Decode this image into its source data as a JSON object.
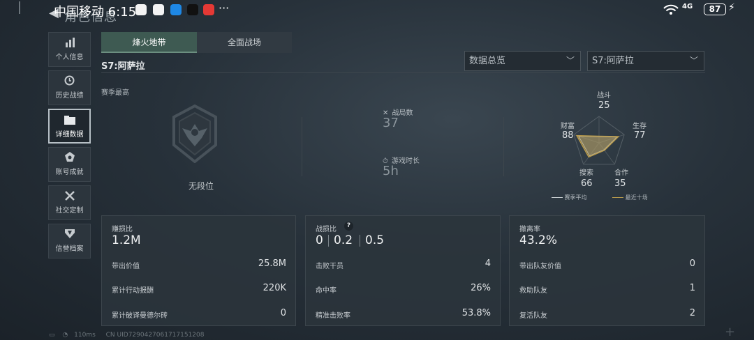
{
  "status_bar": {
    "carrier_time": "中国移动 6:15",
    "network": "4G",
    "battery": "87",
    "overflow": "···"
  },
  "header": {
    "title": "角色信息"
  },
  "sidebar": {
    "items": [
      {
        "label": "个人信息",
        "icon": "bar-chart-icon"
      },
      {
        "label": "历史战绩",
        "icon": "clock-icon"
      },
      {
        "label": "详细数据",
        "icon": "folder-icon",
        "active": true
      },
      {
        "label": "账号成就",
        "icon": "medal-icon"
      },
      {
        "label": "社交定制",
        "icon": "tools-icon"
      },
      {
        "label": "信誉档案",
        "icon": "shield-icon"
      }
    ]
  },
  "tabs": [
    "烽火地带",
    "全面战场"
  ],
  "season": {
    "title": "S7:阿萨拉",
    "dropdown_view": "数据总览",
    "dropdown_season": "S7:阿萨拉",
    "best_label": "赛季最高",
    "rank_name": "无段位"
  },
  "summary": {
    "matches_label": "战局数",
    "matches_value": "37",
    "playtime_label": "游戏时长",
    "playtime_value": "5h"
  },
  "radar": {
    "axes": [
      {
        "label": "战斗",
        "value": "25"
      },
      {
        "label": "生存",
        "value": "77"
      },
      {
        "label": "合作",
        "value": "35"
      },
      {
        "label": "搜索",
        "value": "66"
      },
      {
        "label": "财富",
        "value": "88"
      }
    ],
    "legend_season": "赛季平均",
    "legend_recent": "最近十场",
    "colors": {
      "season": "#c9ced1",
      "recent": "#b79a4c"
    }
  },
  "cards": {
    "profit": {
      "title": "赚损比",
      "value": "1.2M",
      "rows": [
        {
          "label": "带出价值",
          "value": "25.8M"
        },
        {
          "label": "累计行动报酬",
          "value": "220K"
        },
        {
          "label": "累计破译曼德尔砖",
          "value": "0"
        }
      ]
    },
    "combat": {
      "title": "战损比",
      "help": "?",
      "ratios": [
        "0",
        "0.2",
        "0.5"
      ],
      "rows": [
        {
          "label": "击败干员",
          "value": "4"
        },
        {
          "label": "命中率",
          "value": "26%"
        },
        {
          "label": "精准击败率",
          "value": "53.8%"
        }
      ]
    },
    "extract": {
      "title": "撤离率",
      "value": "43.2%",
      "rows": [
        {
          "label": "带出队友价值",
          "value": "0"
        },
        {
          "label": "救助队友",
          "value": "1"
        },
        {
          "label": "复活队友",
          "value": "2"
        }
      ]
    }
  },
  "bottom": {
    "ping": "110ms",
    "uid": "CN UID7290427061717151208"
  }
}
